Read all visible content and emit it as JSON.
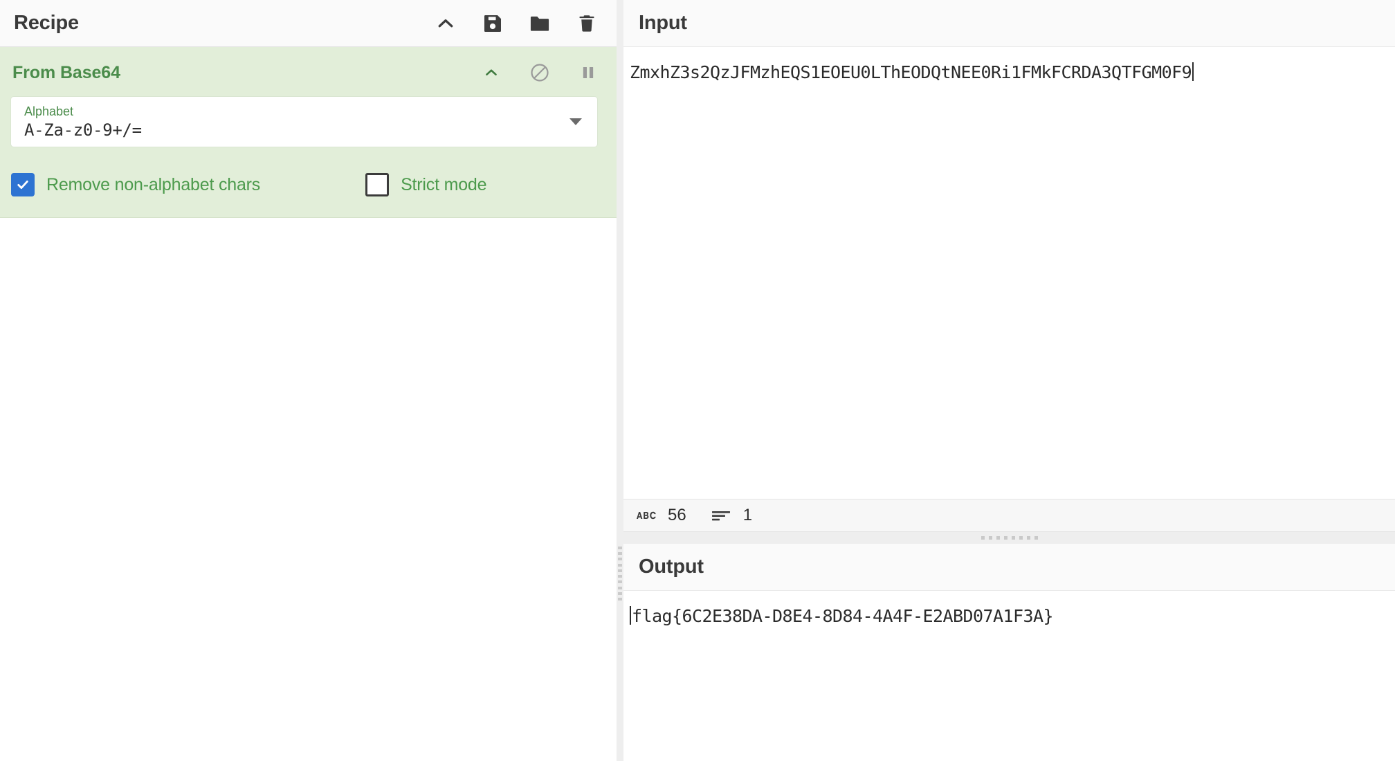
{
  "recipe": {
    "title": "Recipe",
    "toolbar": [
      {
        "name": "collapse-icon",
        "label": "Collapse recipe"
      },
      {
        "name": "save-icon",
        "label": "Save recipe"
      },
      {
        "name": "folder-icon",
        "label": "Load recipe"
      },
      {
        "name": "trash-icon",
        "label": "Clear recipe"
      }
    ],
    "operation": {
      "name": "From Base64",
      "icons": [
        {
          "name": "chevron-up-icon",
          "label": "Hide arguments"
        },
        {
          "name": "disable-icon",
          "label": "Disable operation"
        },
        {
          "name": "pause-icon",
          "label": "Set breakpoint"
        }
      ],
      "arguments": [
        {
          "label": "Alphabet",
          "value": "A-Za-z0-9+/=",
          "type": "editableOptionSelect"
        }
      ],
      "checkboxes": [
        {
          "label": "Remove non-alphabet chars",
          "checked": true
        },
        {
          "label": "Strict mode",
          "checked": false
        }
      ]
    }
  },
  "input": {
    "title": "Input",
    "value": "ZmxhZ3s2QzJFMzhEQS1EOEU0LThEODQtNEE0Ri1FMkFCRDA3QTFGM0F9",
    "status": {
      "length_icon": "abc-icon",
      "length": "56",
      "lines_icon": "lines-icon",
      "lines": "1"
    }
  },
  "output": {
    "title": "Output",
    "value": "flag{6C2E38DA-D8E4-8D84-4A4F-E2ABD07A1F3A}"
  },
  "colors": {
    "operation_bg": "#e2eed9",
    "operation_title": "#4b8c4b",
    "checkbox_checked": "#2d73d2",
    "pane_header_bg": "#fafafa",
    "text": "#2b2b2b"
  }
}
